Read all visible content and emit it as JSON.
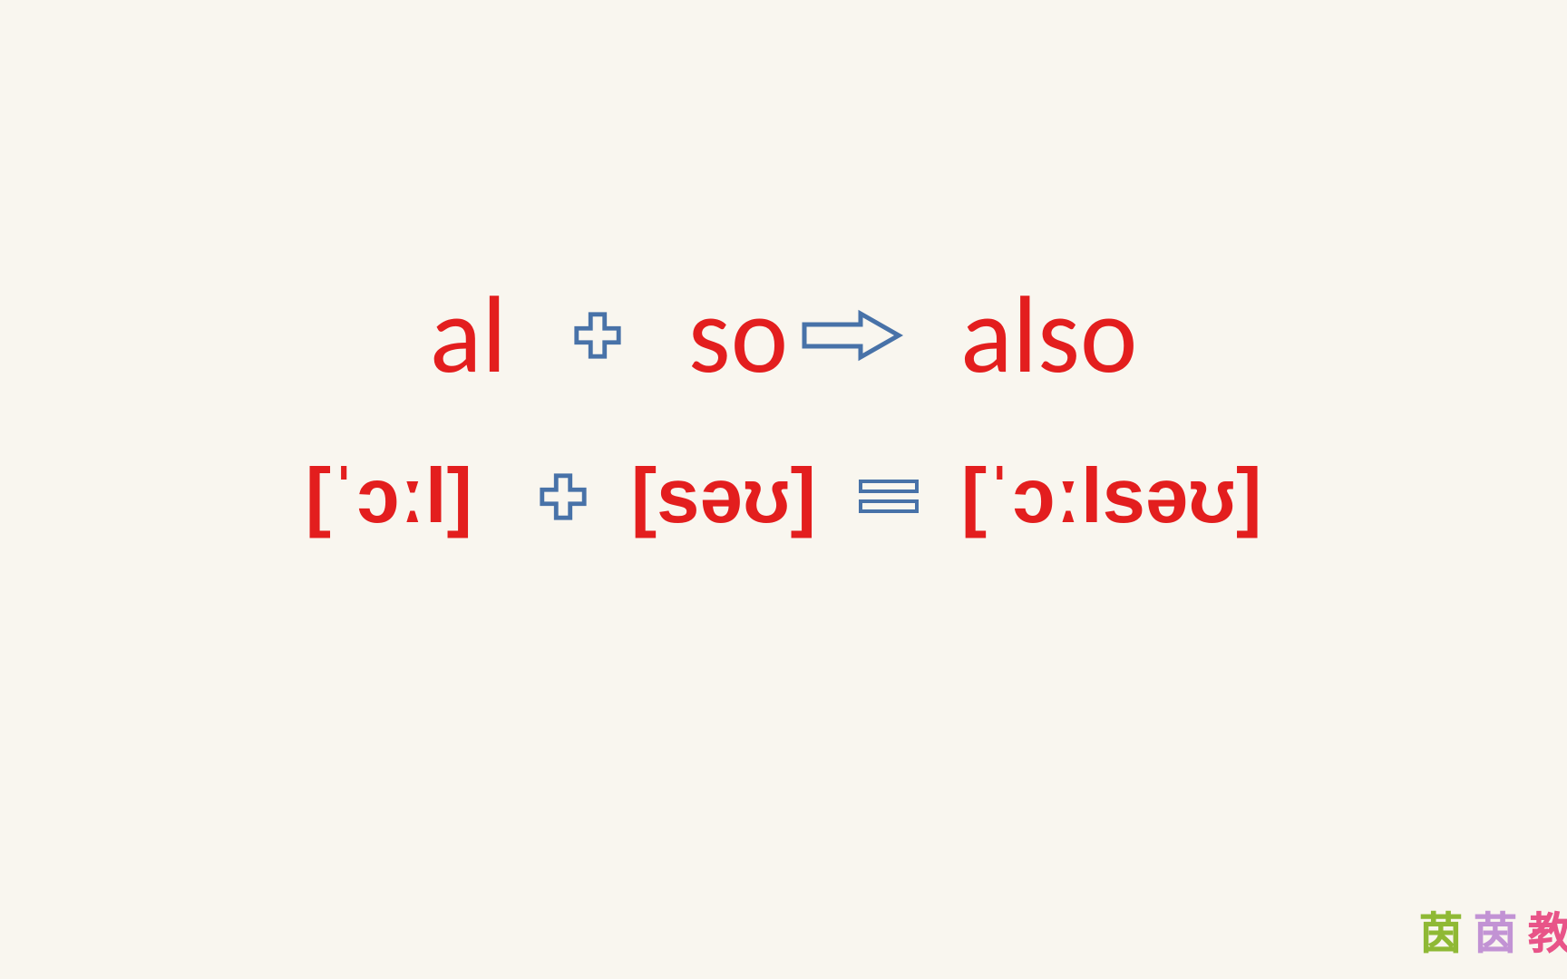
{
  "row1": {
    "part1": "al",
    "part2": "so",
    "result": "also"
  },
  "row2": {
    "phonetic1": "[ˈɔːl]",
    "phonetic2": "[səʊ]",
    "phonetic_result": "[ˈɔːlsəʊ]"
  },
  "watermark": {
    "char1": "茵",
    "char2": "茵",
    "char3": "教"
  },
  "colors": {
    "text_red": "#e31e1e",
    "symbol_blue": "#4872a8",
    "background": "#f9f6ef"
  }
}
